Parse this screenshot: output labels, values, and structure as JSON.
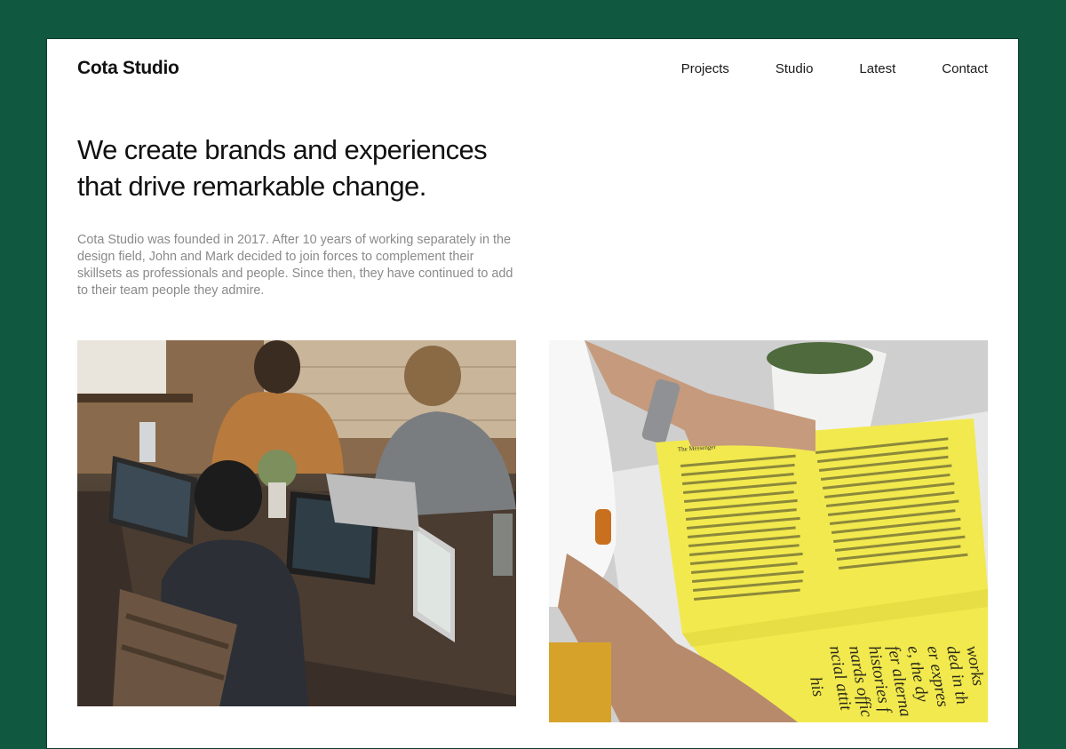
{
  "brand": {
    "name": "Cota Studio"
  },
  "nav": {
    "items": [
      {
        "label": "Projects"
      },
      {
        "label": "Studio"
      },
      {
        "label": "Latest"
      },
      {
        "label": "Contact"
      }
    ]
  },
  "hero": {
    "title_line1": "We create brands and experiences",
    "title_line2": "that drive remarkable change.",
    "intro": "Cota Studio was founded in 2017. After 10 years of working separately in the design field, John and Mark decided to join forces to complement their skillsets as professionals and people. Since then, they have continued to add to their team people they admire."
  },
  "colors": {
    "background": "#115840",
    "card": "#ffffff",
    "intro_text": "#8a8a8a",
    "book_yellow": "#f2e94e"
  },
  "magazine": {
    "header": "The Messenger",
    "large_text": [
      "works",
      "ded in th",
      "er expres",
      "e, the dy",
      "fer alterna",
      "histories f",
      "nards offic",
      "ncial attit",
      "his"
    ]
  }
}
